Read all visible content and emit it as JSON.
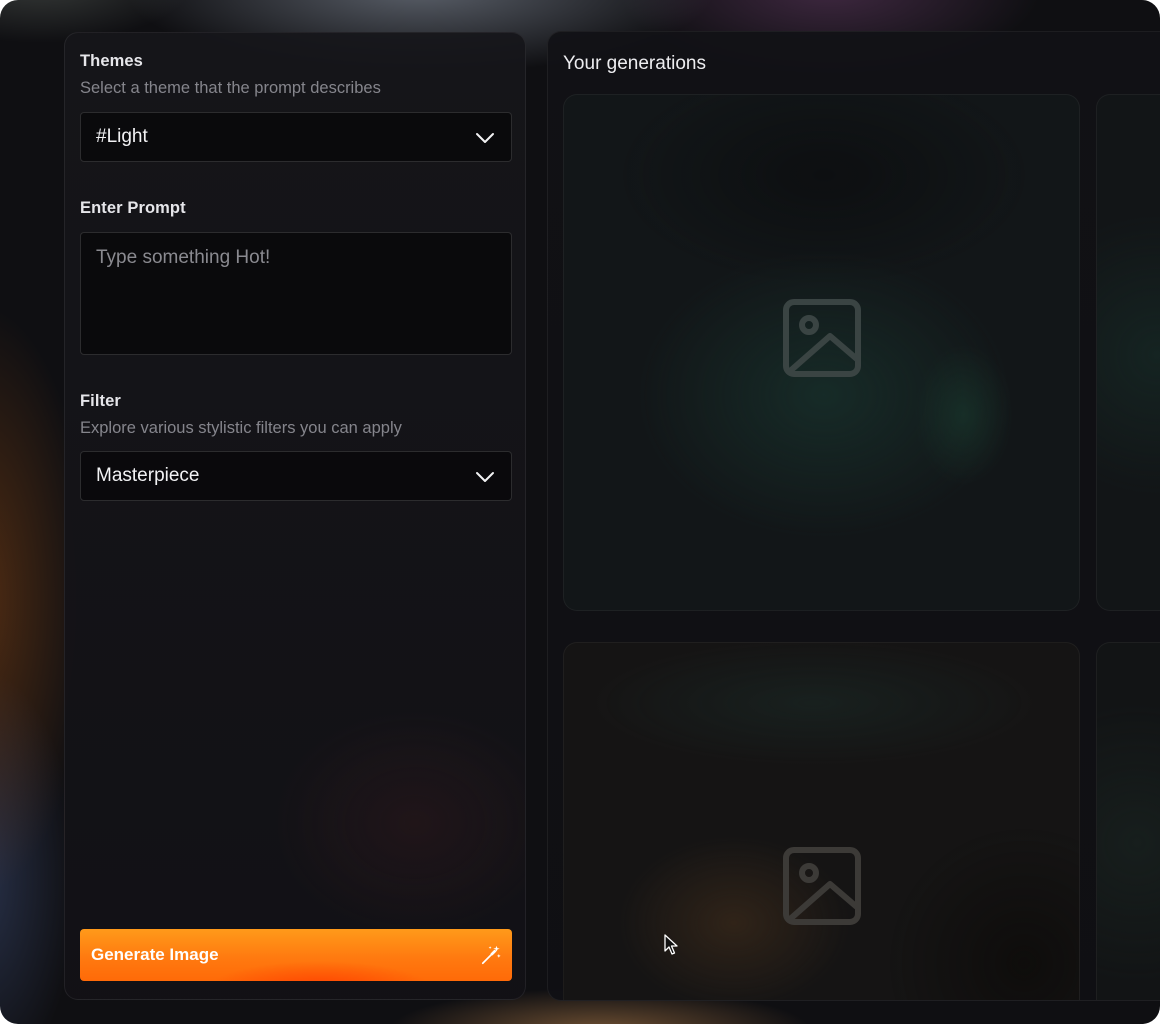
{
  "themes": {
    "title": "Themes",
    "subtitle": "Select a theme that the prompt describes",
    "selected": "#Light"
  },
  "prompt": {
    "title": "Enter Prompt",
    "placeholder": "Type something Hot!",
    "value": ""
  },
  "filter": {
    "title": "Filter",
    "subtitle": "Explore various stylistic filters you can apply",
    "selected": "Masterpiece"
  },
  "generate_button": {
    "label": "Generate Image",
    "icon": "magic-wand-icon",
    "color": "#ff7a10"
  },
  "generations": {
    "title": "Your generations",
    "placeholder_icon": "image-placeholder-icon"
  },
  "colors": {
    "background": "#0f0f12",
    "accent": "#ff7a10"
  }
}
